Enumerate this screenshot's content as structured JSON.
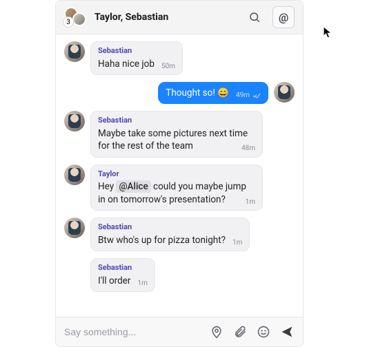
{
  "header": {
    "title": "Taylor, Sebastian",
    "participant_count": "3"
  },
  "messages": [
    {
      "sender": "Sebastian",
      "text": "Haha nice job",
      "time": "50m",
      "mine": false,
      "continued": false
    },
    {
      "sender": "",
      "text": "Thought so! 😄",
      "time": "49m",
      "mine": true,
      "continued": false,
      "read": true
    },
    {
      "sender": "Sebastian",
      "text": "Maybe take some pictures next time for the rest of the team",
      "time": "48m",
      "mine": false,
      "continued": false
    },
    {
      "sender": "Taylor",
      "text_pre": "Hey ",
      "mention": "@Alice",
      "text_post": " could you maybe jump in on tomorrow's presentation?",
      "time": "1m",
      "mine": false,
      "continued": false
    },
    {
      "sender": "Sebastian",
      "text": "Btw who's up for pizza tonight?",
      "time": "1m",
      "mine": false,
      "continued": false
    },
    {
      "sender": "Sebastian",
      "text": "I'll order",
      "time": "1m",
      "mine": false,
      "continued": true
    }
  ],
  "composer": {
    "placeholder": "Say something..."
  }
}
